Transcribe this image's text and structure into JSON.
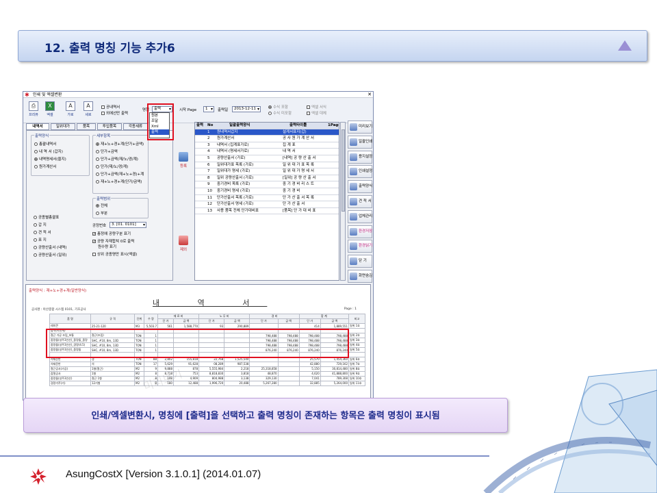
{
  "slide": {
    "title": "12. 출력 명칭 기능 추가6",
    "caption": "인쇄/엑셀변환시, 명칭에 [출력]을 선택하고 출력 명칭이 존재하는 항목은 출력 명칭이 표시됨",
    "footer": "AsungCostX    [Version 3.1.0.1]    (2014.01.07)"
  },
  "app": {
    "window_title": "인쇄 및 엑셀변환",
    "toolbar": {
      "btn_preview": "프리뷰",
      "btn_excel": "엑셀",
      "btn_horizontal": "가로",
      "btn_vertical": "세로",
      "chk_empty": "공내역서",
      "chk_exclude_out": "외에선만 출력",
      "name_label": "명칭",
      "name_value": "출력",
      "start_page_label": "시작 Page",
      "start_page_value": "1",
      "print_date_label": "출력일",
      "print_date_value": "2013-12-11",
      "opt_qty_incl": "수식 포함",
      "opt_qty_excl": "수식 미포함",
      "chk_excel_style": "엑셀 서식",
      "chk_excel_single": "엑셀 대체"
    },
    "dropdown_options": [
      "원본",
      "조달",
      "Xml",
      "출력"
    ],
    "dropdown_selected": "출력",
    "tabs": [
      "내역서",
      "일위대가",
      "품목",
      "투입품목",
      "각종세류"
    ],
    "active_tab": "내역서",
    "output_form": {
      "title": "출력양식",
      "options": [
        "총괄내역서",
        "내 역 서 (갑지)",
        "내역명세서(을지)",
        "원가계산서"
      ],
      "selected": "내역명세서(을지)"
    },
    "detail_form": {
      "title": "세부항목",
      "options": [
        "재+노+경+계(단가+금액)",
        "단가+금액",
        "단가+금액(재/노/경/계)",
        "단가(재/노/경/계)",
        "단가+금액(재+노+경)+계",
        "재+노+경+계(단가/금액)"
      ],
      "selected": "재+노+경+계(단가+금액)"
    },
    "print_range": {
      "title": "출력범위",
      "options": [
        "전체",
        "부분"
      ],
      "selected": "전체"
    },
    "left_lower_options": [
      "공종별총괄표",
      "갑 지",
      "견 적 서",
      "표 지",
      "공량산출서 (내역)",
      "공량산출서 (일위)"
    ],
    "process_no_label": "공정번호",
    "process_no_value": "3. [01. 0101]",
    "chk_show_process": "총정에 공량구분 표기",
    "chk_repeat_label": "공량 자재합쳐 0로 출력",
    "chk_repeat_sub": "원수량 표기",
    "chk_show_upper": "상위 공종명만 표시(엑셀)",
    "btn_add": "등록",
    "btn_remove": "제외",
    "grid": {
      "headers": [
        "출력",
        "No",
        "일괄출력양식",
        "출력타이틀",
        "1Page"
      ],
      "rows": [
        [
          "1",
          "원내역서갑지",
          "설계서표지(갑)"
        ],
        [
          "2",
          "원가계산서",
          "공 사 원 가 계 산 서"
        ],
        [
          "3",
          "내역서 (집계표가로)",
          "집 계 표"
        ],
        [
          "4",
          "내역서 (명세서가로)",
          "내 역 서"
        ],
        [
          "5",
          "공량산출서 (가로)",
          "[내역] 공 량 산 출 서"
        ],
        [
          "6",
          "일위대가표 목록 (가로)",
          "일 위 대 가 표 목 록"
        ],
        [
          "7",
          "일위대가 명세 (가로)",
          "일 위 대 가 명 세 서"
        ],
        [
          "8",
          "일위 공량산출서 (가로)",
          "[일위] 공 량 산 출 서"
        ],
        [
          "9",
          "중기경비 목록 (가로)",
          "중 기 경 비 리 스 트"
        ],
        [
          "10",
          "중기경비 명세 (가로)",
          "중 기 경 비"
        ],
        [
          "11",
          "단가산출서 목록 (가로)",
          "단 가 산 출 서 목 록"
        ],
        [
          "12",
          "단가산출서 명세 (가로)",
          "단 가 산 출 서"
        ],
        [
          "13",
          "사용 품목 전체 단가대비표",
          "[품목] 단 가 대 비 표"
        ]
      ],
      "selected_row": 0
    },
    "right_buttons": [
      "미리보기",
      "일괄인쇄",
      "용지설정",
      "인쇄설정",
      "출력양식",
      "견 적 서",
      "업체관리",
      "환경저장",
      "환경읽기",
      "닫 기",
      "화면숨김"
    ],
    "preview": {
      "top_label": "출력양식 : 재+노+경+계(일반양식)",
      "doc_title": "내 역 서",
      "meta": "공사명 : 아산종합 시스템 0101, 기초공사",
      "page_label": "Page :   1",
      "col_headers": [
        "품 명",
        "규 격",
        "단위",
        "수 량",
        "재 료 비",
        "노 무 비",
        "경 비",
        "합 계",
        "비고"
      ],
      "sub_headers": [
        "단 가",
        "금 액",
        "단 가",
        "금 액",
        "단 가",
        "금 액",
        "단 가",
        "금 액"
      ],
      "rows": [
        [
          "레미콘",
          "25-21-120",
          "M3",
          "5,503.7",
          "561",
          "1,588,770",
          "93",
          "290,889",
          "",
          "",
          "414",
          "1,889,551",
          "일위 1호"
        ],
        [
          "잡석(이산게)",
          "",
          "",
          "",
          "",
          "",
          "",
          "",
          "",
          "",
          "",
          "",
          ""
        ],
        [
          "철근 가공 조립_보통",
          "철근(조립)",
          "TON",
          "1",
          "",
          "",
          "",
          "",
          "798,488",
          "798,488",
          "798,488",
          "798,488",
          "일위 2호"
        ],
        [
          "중량돌(성주3인산)_중량돌_중량",
          "SHC, #10, 8m, 13D",
          "TON",
          "1",
          "",
          "",
          "",
          "",
          "798,488",
          "798,488",
          "798,488",
          "798,488",
          "일위 3호"
        ],
        [
          "중량돌(성주3인산)_경량(4.5)",
          "SHC, #10, 8m, 13D",
          "TON",
          "1",
          "",
          "",
          "",
          "",
          "798,488",
          "798,488",
          "798,488",
          "798,488",
          "일위 4호"
        ],
        [
          "중량돌(성주3인산)_중량돌",
          "SHC, #10, 8m, 13D",
          "TON",
          "1",
          "",
          "",
          "",
          "",
          "876,240",
          "876,240",
          "876,240",
          "876,240",
          "일위 5호"
        ],
        [
          "",
          "",
          "",
          "",
          "",
          "",
          "",
          "",
          "",
          "",
          "",
          "",
          ""
        ],
        [
          "석재운반",
          "경",
          "TON",
          "88",
          "2,802",
          "155,818",
          "22,768",
          "1,525,544",
          "",
          "",
          "25,570",
          "1,454,360",
          "일위 6호"
        ],
        [
          "석재운반",
          "석",
          "TON",
          "17",
          "5,629",
          "91,628",
          "08,289",
          "987,538",
          "",
          "",
          "42,880",
          "729,162",
          "일위 7호"
        ],
        [
          "철근공사(가공)",
          "1형(철근)",
          "M2",
          "9",
          "9,888",
          "878",
          "5,555,984",
          "2,218",
          "25,318,858",
          "",
          "5,150",
          "30,814,480",
          "일위 8호"
        ],
        [
          "잡철공사",
          "1형",
          "M2",
          "8",
          "8,718",
          "753",
          "8,818,830",
          "3,818",
          "48,870",
          "",
          "4,620",
          "41,888,800",
          "일위 9호"
        ],
        [
          "중량돌(성주3인산)",
          "철근 1형",
          "M2",
          "8",
          "108",
          "4,909",
          "804,988",
          "3,138",
          "329,130",
          "",
          "7,041",
          "789,308",
          "일위 10호"
        ],
        [
          "경량거주(가)",
          "12기형",
          "M2",
          "8",
          "180",
          "12,488",
          "1,996,720",
          "20,488",
          "5,267,280",
          "",
          "32,885",
          "5,264,000",
          "일위 11호"
        ]
      ]
    }
  }
}
